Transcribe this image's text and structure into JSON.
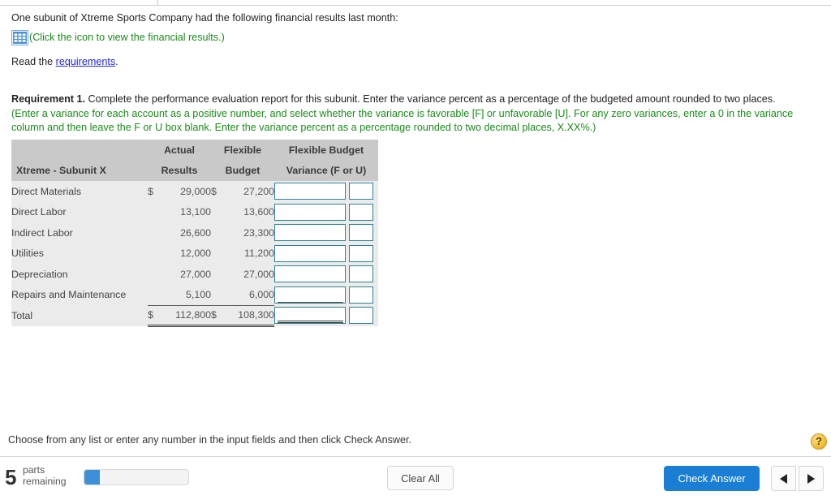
{
  "intro": {
    "sentence": "One subunit of Xtreme Sports Company had the following financial results last month:",
    "icon_name": "spreadsheet-icon",
    "icon_caption": "(Click the icon to view the financial results.)",
    "read_prefix": "Read the ",
    "read_link": "requirements",
    "read_suffix": "."
  },
  "requirement": {
    "label": "Requirement 1.",
    "text": " Complete the performance evaluation report for this subunit. Enter the variance percent as a percentage of the budgeted amount rounded to two places.",
    "note": "(Enter a variance for each account as a positive number, and select whether the variance is favorable [F] or unfavorable [U]. For any zero variances, enter a 0 in the variance column and then leave the F or U box blank. Enter the variance percent as a percentage rounded to two decimal places, X.XX%.)"
  },
  "table": {
    "headers": {
      "row1": [
        "",
        "Actual",
        "Flexible",
        "Flexible Budget"
      ],
      "row2": [
        "Xtreme - Subunit X",
        "Results",
        "Budget",
        "Variance (F or U)"
      ]
    },
    "rows": [
      {
        "label": "Direct Materials",
        "actual_currency": "$",
        "actual": "29,000",
        "budget_currency": "$",
        "budget": "27,200",
        "variance": "",
        "flag": "",
        "rule": "none"
      },
      {
        "label": "Direct Labor",
        "actual_currency": "",
        "actual": "13,100",
        "budget_currency": "",
        "budget": "13,600",
        "variance": "",
        "flag": "",
        "rule": "none"
      },
      {
        "label": "Indirect Labor",
        "actual_currency": "",
        "actual": "26,600",
        "budget_currency": "",
        "budget": "23,300",
        "variance": "",
        "flag": "",
        "rule": "none"
      },
      {
        "label": "Utilities",
        "actual_currency": "",
        "actual": "12,000",
        "budget_currency": "",
        "budget": "11,200",
        "variance": "",
        "flag": "",
        "rule": "none"
      },
      {
        "label": "Depreciation",
        "actual_currency": "",
        "actual": "27,000",
        "budget_currency": "",
        "budget": "27,000",
        "variance": "",
        "flag": "",
        "rule": "none"
      },
      {
        "label": "Repairs and Maintenance",
        "actual_currency": "",
        "actual": "5,100",
        "budget_currency": "",
        "budget": "6,000",
        "variance": "",
        "flag": "",
        "rule": "single"
      },
      {
        "label": "Total",
        "actual_currency": "$",
        "actual": "112,800",
        "budget_currency": "$",
        "budget": "108,300",
        "variance": "",
        "flag": "",
        "rule": "double"
      }
    ]
  },
  "footer": {
    "help_text": "Choose from any list or enter any number in the input fields and then click Check Answer.",
    "help_badge": "?",
    "parts_count": "5",
    "parts_label_line1": "parts",
    "parts_label_line2": "remaining",
    "progress_percent": 15,
    "clear_label": "Clear All",
    "check_label": "Check Answer",
    "prev_icon": "triangle-left-icon",
    "next_icon": "triangle-right-icon"
  },
  "colors": {
    "link": "#2222dd",
    "green_note": "#1a8a1a",
    "header_bg": "#c9c9c9",
    "body_bg": "#ebebeb",
    "input_border": "#2e8296",
    "primary_button": "#1a7fd4",
    "progress_fill": "#3d90d7",
    "help_badge": "#f3c23c"
  }
}
